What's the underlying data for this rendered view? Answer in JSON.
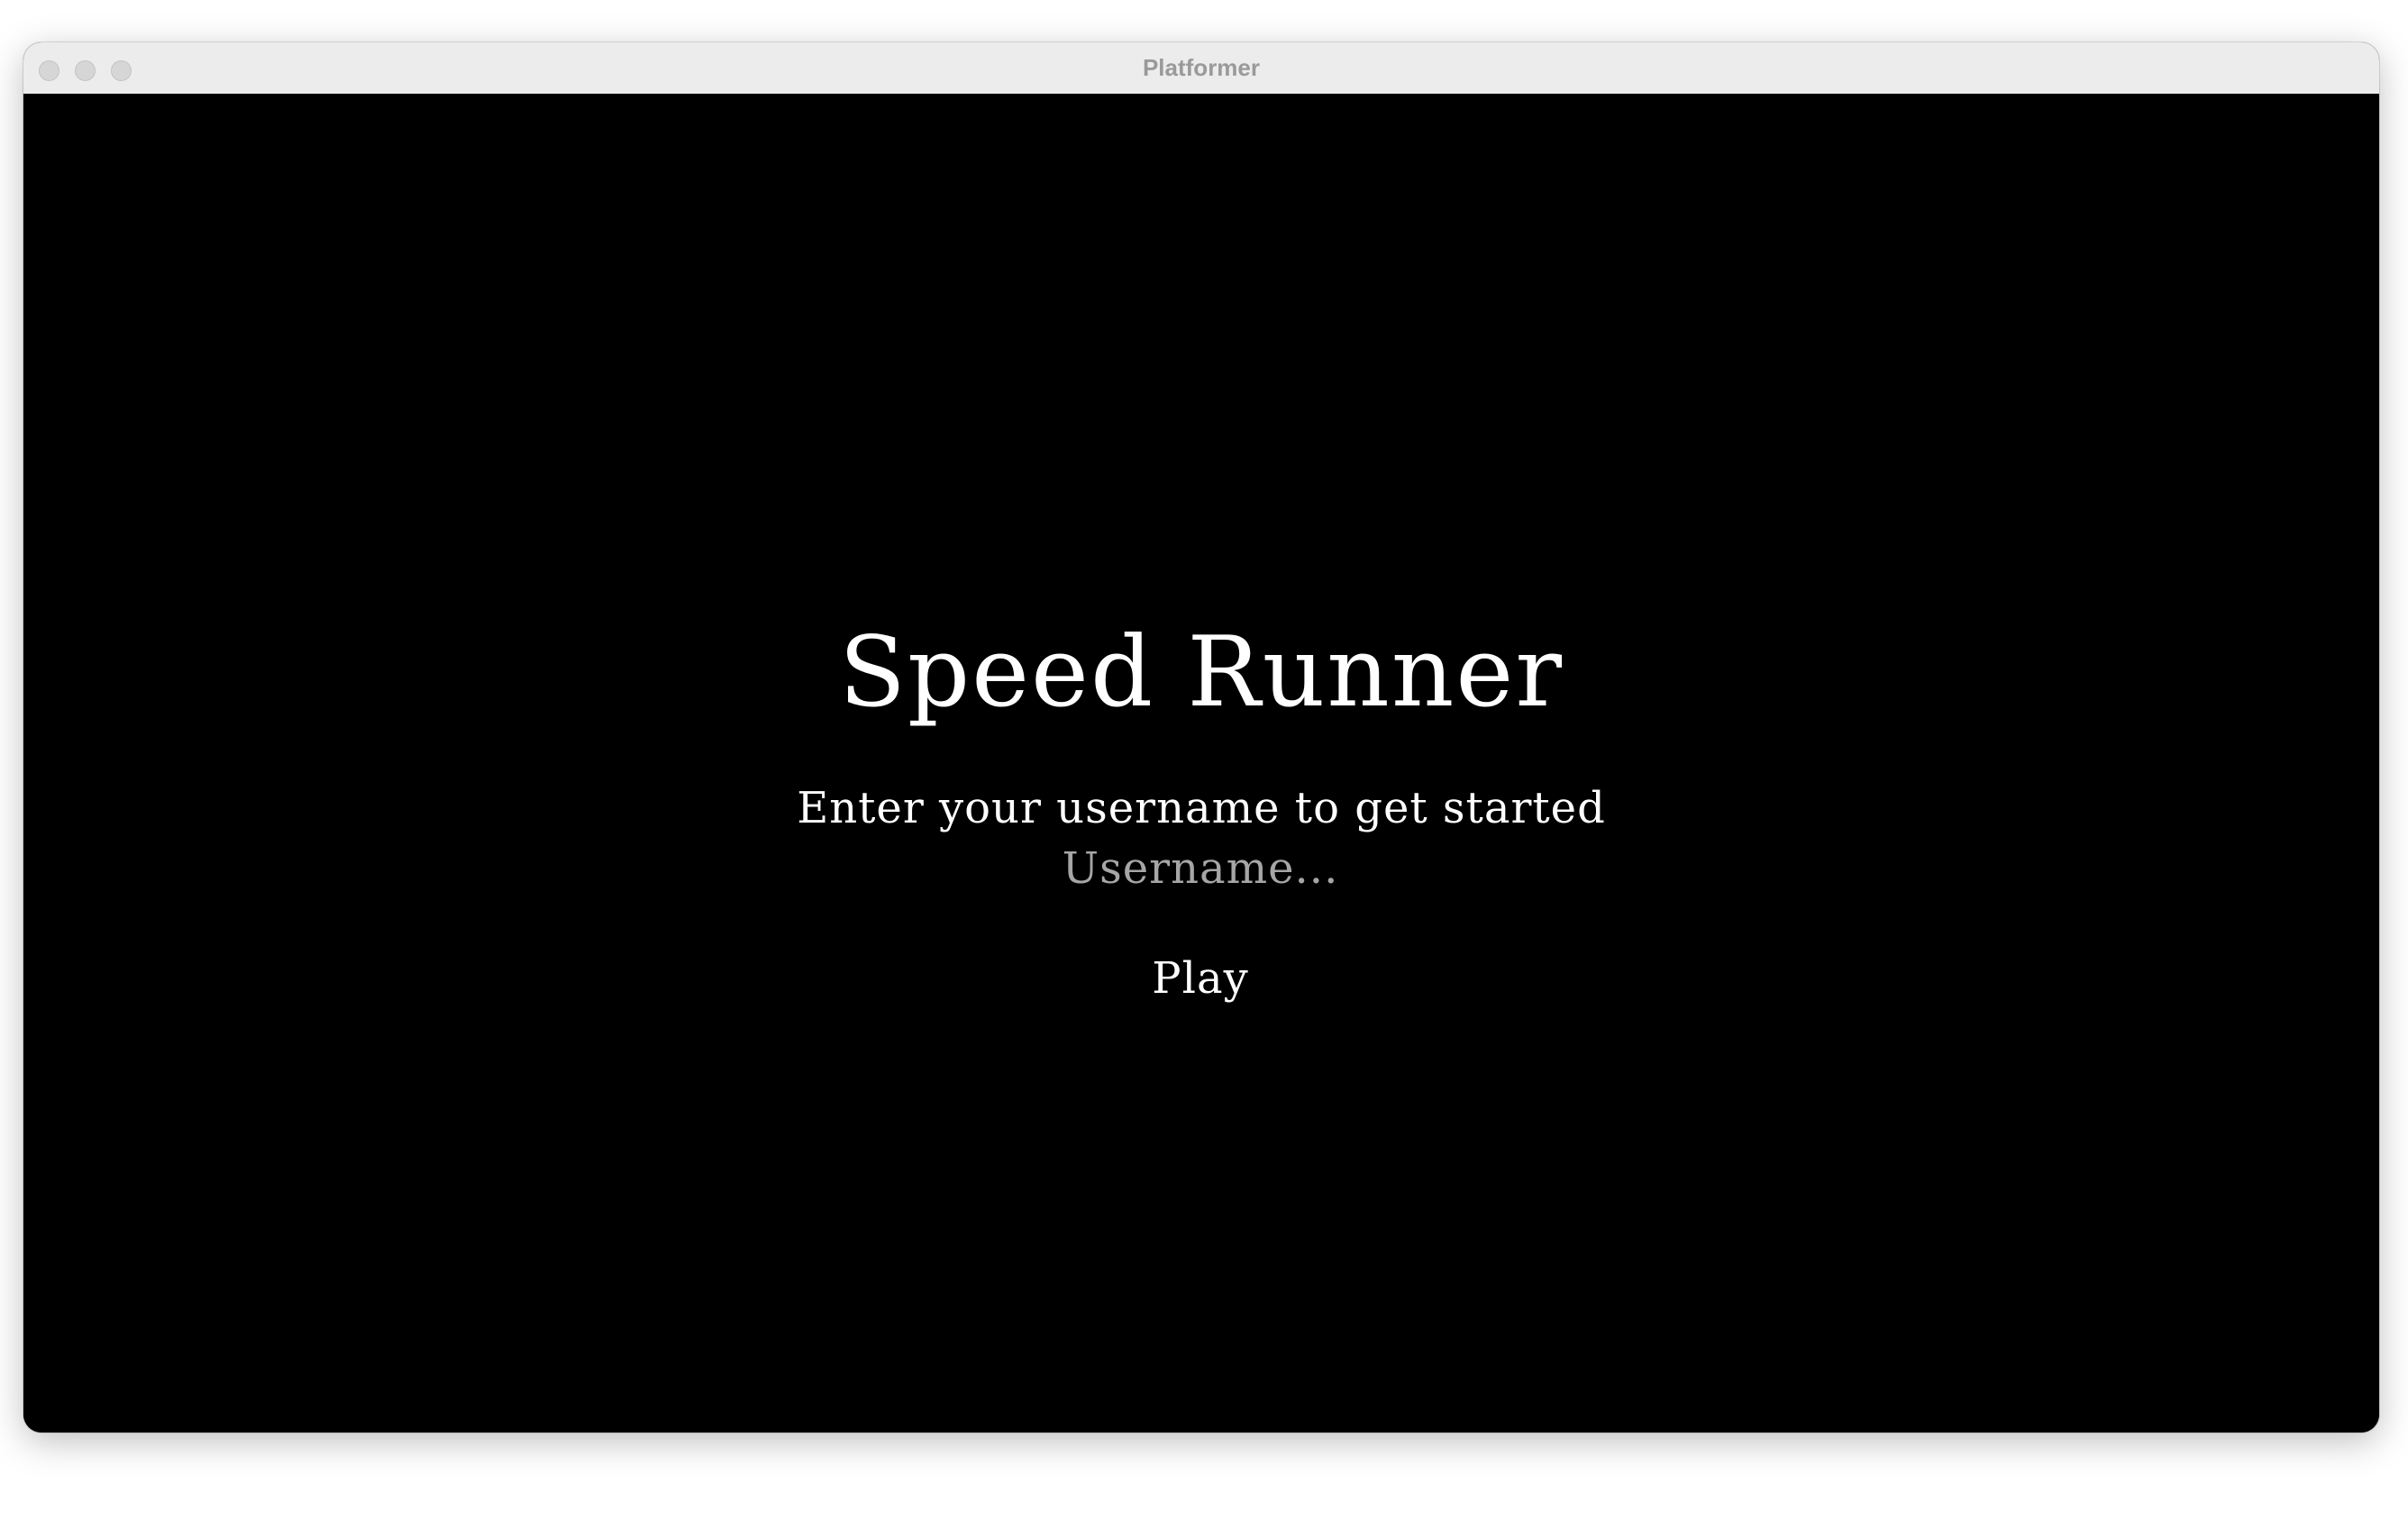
{
  "window": {
    "title": "Platformer"
  },
  "game": {
    "title": "Speed Runner",
    "prompt": "Enter your username to get started",
    "username_placeholder": "Username...",
    "username_value": "",
    "play_label": "Play"
  },
  "colors": {
    "background": "#000000",
    "text": "#ffffff",
    "placeholder": "#a6a6a6",
    "titlebar": "#ececec"
  }
}
